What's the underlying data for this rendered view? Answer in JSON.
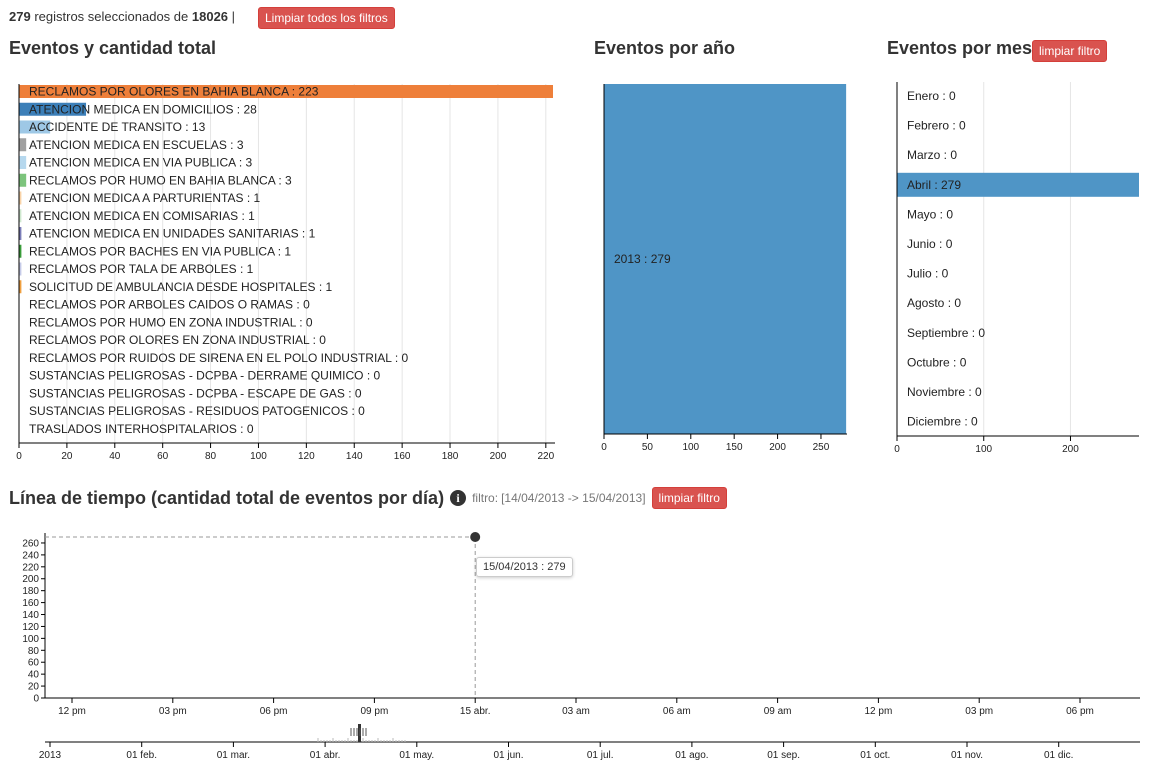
{
  "header": {
    "count": "279",
    "text_mid": "registros seleccionados de",
    "total": "18026",
    "sep": "|",
    "clear_all": "Limpiar todos los filtros"
  },
  "colors": {
    "orange": "#ee7f3a",
    "blue": "#4f95c6",
    "steel": "#3c7fb8",
    "grid": "#e5e5e5"
  },
  "events": {
    "title": "Eventos y cantidad total",
    "chart_data": {
      "type": "bar",
      "orientation": "horizontal",
      "xlim": [
        0,
        223
      ],
      "xticks": [
        0,
        20,
        40,
        60,
        80,
        100,
        120,
        140,
        160,
        180,
        200,
        220
      ],
      "categories": [
        "RECLAMOS POR OLORES EN BAHIA BLANCA",
        "ATENCION MEDICA EN DOMICILIOS",
        "ACCIDENTE DE TRANSITO",
        "ATENCION MEDICA EN ESCUELAS",
        "ATENCION MEDICA EN VIA PUBLICA",
        "RECLAMOS POR HUMO EN BAHIA BLANCA",
        "ATENCION MEDICA A PARTURIENTAS",
        "ATENCION MEDICA EN COMISARIAS",
        "ATENCION MEDICA EN UNIDADES SANITARIAS",
        "RECLAMOS POR BACHES EN VIA PUBLICA",
        "RECLAMOS POR TALA DE ARBOLES",
        "SOLICITUD DE AMBULANCIA DESDE HOSPITALES",
        "RECLAMOS POR ARBOLES CAIDOS O RAMAS",
        "RECLAMOS POR HUMO EN ZONA INDUSTRIAL",
        "RECLAMOS POR OLORES EN ZONA INDUSTRIAL",
        "RECLAMOS POR RUIDOS DE SIRENA EN EL POLO INDUSTRIAL",
        "SUSTANCIAS PELIGROSAS - DCPBA - DERRAME QUIMICO",
        "SUSTANCIAS PELIGROSAS - DCPBA - ESCAPE DE GAS",
        "SUSTANCIAS PELIGROSAS - RESIDUOS PATOGENICOS",
        "TRASLADOS INTERHOSPITALARIOS"
      ],
      "values": [
        223,
        28,
        13,
        3,
        3,
        3,
        1,
        1,
        1,
        1,
        1,
        1,
        0,
        0,
        0,
        0,
        0,
        0,
        0,
        0
      ],
      "bar_colors": [
        "#ee7f3a",
        "#3c7fb8",
        "#9ec8e6",
        "#a0a0a0",
        "#b6d8ee",
        "#7cc47c",
        "#f9d3a8",
        "#cfe8cf",
        "#7b7db8",
        "#3a9c3a",
        "#c6cbe8",
        "#f0a040",
        "#cccccc",
        "#cccccc",
        "#cccccc",
        "#cccccc",
        "#cccccc",
        "#cccccc",
        "#cccccc",
        "#cccccc"
      ]
    }
  },
  "years": {
    "title": "Eventos por año",
    "chart_data": {
      "type": "bar",
      "orientation": "horizontal",
      "categories": [
        "2013"
      ],
      "values": [
        279
      ],
      "xlim": [
        0,
        280
      ],
      "xticks": [
        0,
        50,
        100,
        150,
        200,
        250
      ]
    }
  },
  "months": {
    "title": "Eventos por mes",
    "clear": "limpiar filtro",
    "chart_data": {
      "type": "bar",
      "orientation": "horizontal",
      "categories": [
        "Enero",
        "Febrero",
        "Marzo",
        "Abril",
        "Mayo",
        "Junio",
        "Julio",
        "Agosto",
        "Septiembre",
        "Octubre",
        "Noviembre",
        "Diciembre"
      ],
      "values": [
        0,
        0,
        0,
        279,
        0,
        0,
        0,
        0,
        0,
        0,
        0,
        0
      ],
      "xlim": [
        0,
        279
      ],
      "xticks": [
        0,
        100,
        200
      ]
    }
  },
  "timeline": {
    "title": "Línea de tiempo (cantidad total de eventos por día)",
    "info_icon": "info-icon",
    "filter_label": "filtro:",
    "filter_value": "[14/04/2013 -> 15/04/2013]",
    "clear": "limpiar filtro",
    "tooltip": "15/04/2013 : 279",
    "chart_data": {
      "type": "line",
      "ylim": [
        0,
        270
      ],
      "yticks": [
        0,
        20,
        40,
        60,
        80,
        100,
        120,
        140,
        160,
        180,
        200,
        220,
        240,
        260
      ],
      "point": {
        "x": "15 abr.",
        "y": 279
      },
      "x_ticks": [
        "12 pm",
        "03 pm",
        "06 pm",
        "09 pm",
        "15 abr.",
        "03 am",
        "06 am",
        "09 am",
        "12 pm",
        "03 pm",
        "06 pm"
      ]
    },
    "overview_ticks": [
      "2013",
      "01 feb.",
      "01 mar.",
      "01 abr.",
      "01 may.",
      "01 jun.",
      "01 jul.",
      "01 ago.",
      "01 sep.",
      "01 oct.",
      "01 nov.",
      "01 dic."
    ]
  }
}
